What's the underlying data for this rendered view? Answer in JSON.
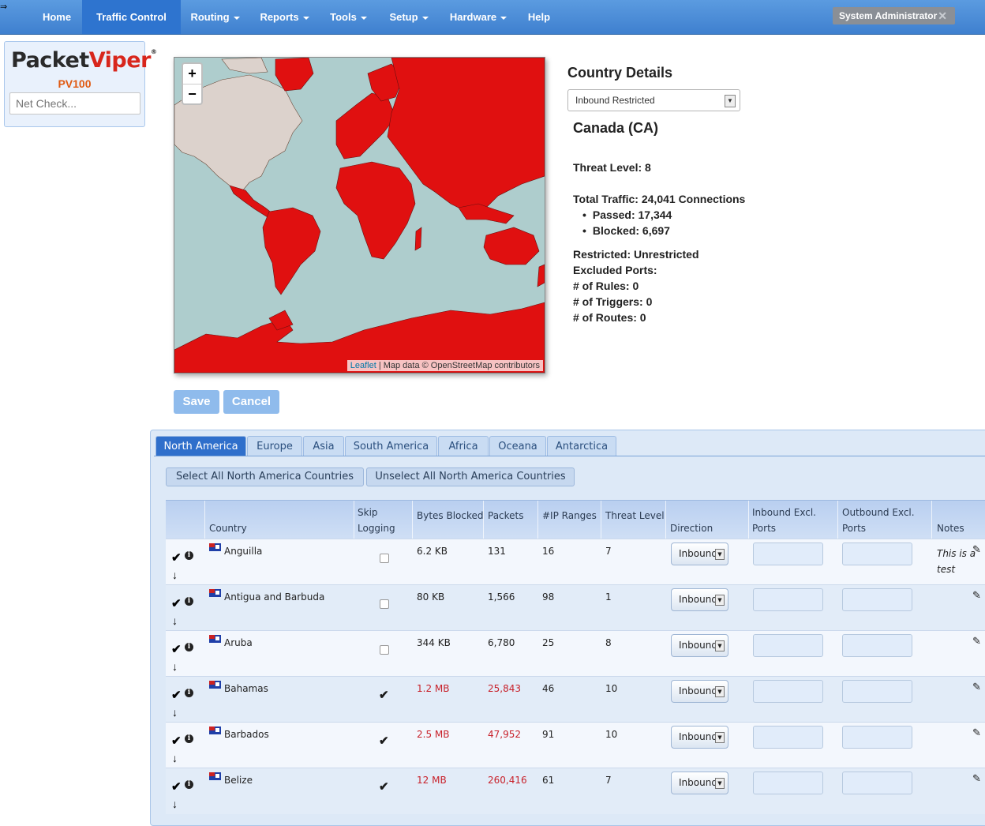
{
  "nav": {
    "items": [
      {
        "label": "Home",
        "has_caret": false
      },
      {
        "label": "Traffic Control",
        "has_caret": false,
        "active": true
      },
      {
        "label": "Routing",
        "has_caret": true
      },
      {
        "label": "Reports",
        "has_caret": true
      },
      {
        "label": "Tools",
        "has_caret": true
      },
      {
        "label": "Setup",
        "has_caret": true
      },
      {
        "label": "Hardware",
        "has_caret": true
      },
      {
        "label": "Help",
        "has_caret": false
      }
    ],
    "user": "System Administrator",
    "user_close_icon": "close-icon"
  },
  "brand": {
    "logo_part1": "Packet",
    "logo_part2": "Viper",
    "logo_mark": "®",
    "model": "PV100",
    "netcheck_placeholder": "Net Check..."
  },
  "map": {
    "zoom_in": "+",
    "zoom_out": "−",
    "attribution_link": "Leaflet",
    "attribution_text": "| Map data © OpenStreetMap contributors",
    "land_color": "#dcd2cc",
    "restricted_color": "#e01010",
    "water_color": "#aecdcd"
  },
  "details": {
    "title": "Country Details",
    "filter_value": "Inbound Restricted",
    "country": "Canada (CA)",
    "threat_level": "Threat Level: 8",
    "total_traffic": "Total Traffic: 24,041 Connections",
    "passed": "Passed: 17,344",
    "blocked": "Blocked: 6,697",
    "restricted": "Restricted: Unrestricted",
    "excluded_ports": "Excluded Ports:",
    "rules": "# of Rules: 0",
    "triggers": "# of Triggers: 0",
    "routes": "# of Routes: 0"
  },
  "actions": {
    "save": "Save",
    "cancel": "Cancel"
  },
  "tabs": [
    "North America",
    "Europe",
    "Asia",
    "South America",
    "Africa",
    "Oceana",
    "Antarctica"
  ],
  "select_buttons": {
    "select_all": "Select All North America Countries",
    "unselect_all": "Unselect All North America Countries"
  },
  "table": {
    "headers": {
      "country": "Country",
      "skip_logging_1": "Skip",
      "skip_logging_2": "Logging",
      "bytes_blocked": "Bytes Blocked",
      "packets": "Packets",
      "ip_ranges": "#IP Ranges",
      "threat_level": "Threat Level",
      "direction": "Direction",
      "inbound_excl_1": "Inbound Excl.",
      "inbound_excl_2": "Ports",
      "outbound_excl_1": "Outbound Excl.",
      "outbound_excl_2": "Ports",
      "notes": "Notes"
    },
    "rows": [
      {
        "country": "Anguilla",
        "skip": false,
        "bytes": "6.2 KB",
        "packets": "131",
        "ip_ranges": "16",
        "threat": "7",
        "direction": "Inbound",
        "note_line1": "This is a",
        "note_line2": "test",
        "highlight": false
      },
      {
        "country": "Antigua and Barbuda",
        "skip": false,
        "bytes": "80 KB",
        "packets": "1,566",
        "ip_ranges": "98",
        "threat": "1",
        "direction": "Inbound",
        "note_line1": "",
        "note_line2": "",
        "highlight": false
      },
      {
        "country": "Aruba",
        "skip": false,
        "bytes": "344 KB",
        "packets": "6,780",
        "ip_ranges": "25",
        "threat": "8",
        "direction": "Inbound",
        "note_line1": "",
        "note_line2": "",
        "highlight": false
      },
      {
        "country": "Bahamas",
        "skip": true,
        "bytes": "1.2 MB",
        "packets": "25,843",
        "ip_ranges": "46",
        "threat": "10",
        "direction": "Inbound",
        "note_line1": "",
        "note_line2": "",
        "highlight": true
      },
      {
        "country": "Barbados",
        "skip": true,
        "bytes": "2.5 MB",
        "packets": "47,952",
        "ip_ranges": "91",
        "threat": "10",
        "direction": "Inbound",
        "note_line1": "",
        "note_line2": "",
        "highlight": true
      },
      {
        "country": "Belize",
        "skip": true,
        "bytes": "12 MB",
        "packets": "260,416",
        "ip_ranges": "61",
        "threat": "7",
        "direction": "Inbound",
        "note_line1": "",
        "note_line2": "",
        "highlight": true
      }
    ]
  }
}
